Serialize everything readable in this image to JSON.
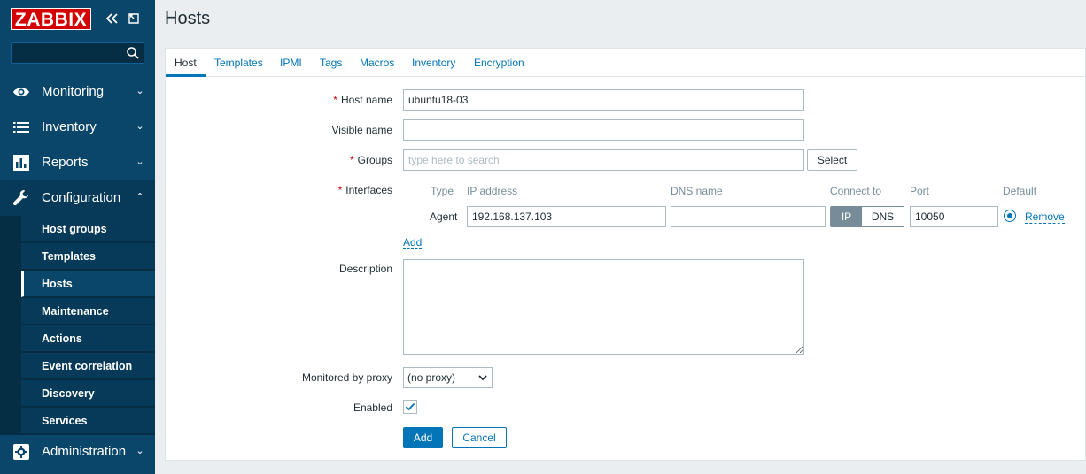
{
  "sidebar": {
    "logo": "ZABBIX",
    "search": {
      "value": "",
      "placeholder": ""
    },
    "menu": [
      {
        "label": "Monitoring",
        "icon": "eye-icon"
      },
      {
        "label": "Inventory",
        "icon": "list-icon"
      },
      {
        "label": "Reports",
        "icon": "bar-chart-icon"
      },
      {
        "label": "Configuration",
        "icon": "wrench-icon",
        "expanded": true
      },
      {
        "label": "Administration",
        "icon": "gear-icon"
      }
    ],
    "submenu": [
      {
        "label": "Host groups"
      },
      {
        "label": "Templates"
      },
      {
        "label": "Hosts",
        "selected": true
      },
      {
        "label": "Maintenance"
      },
      {
        "label": "Actions"
      },
      {
        "label": "Event correlation"
      },
      {
        "label": "Discovery"
      },
      {
        "label": "Services"
      }
    ]
  },
  "header": {
    "title": "Hosts"
  },
  "tabs": [
    "Host",
    "Templates",
    "IPMI",
    "Tags",
    "Macros",
    "Inventory",
    "Encryption"
  ],
  "active_tab": "Host",
  "form": {
    "host_name": {
      "label": "Host name",
      "required": "*",
      "value": "ubuntu18-03"
    },
    "visible_name": {
      "label": "Visible name",
      "value": ""
    },
    "groups": {
      "label": "Groups",
      "required": "*",
      "placeholder": "type here to search",
      "select_button": "Select"
    },
    "interfaces": {
      "label": "Interfaces",
      "required": "*",
      "columns": [
        "Type",
        "IP address",
        "DNS name",
        "Connect to",
        "Port",
        "Default"
      ],
      "row": {
        "type": "Agent",
        "ip": "192.168.137.103",
        "dns": "",
        "connect_ip": "IP",
        "connect_dns": "DNS",
        "connect_selected": "IP",
        "port": "10050",
        "remove_label": "Remove"
      },
      "add_label": "Add"
    },
    "description": {
      "label": "Description",
      "value": ""
    },
    "proxy": {
      "label": "Monitored by proxy",
      "value": "(no proxy)"
    },
    "enabled": {
      "label": "Enabled",
      "checked": true
    },
    "buttons": {
      "add": "Add",
      "cancel": "Cancel"
    }
  },
  "colors": {
    "sidebar_bg": "#0a466a",
    "submenu_bg": "#073a58",
    "logo_red": "#d40000",
    "accent_blue": "#0275b8",
    "page_bg": "#ebeef0"
  }
}
